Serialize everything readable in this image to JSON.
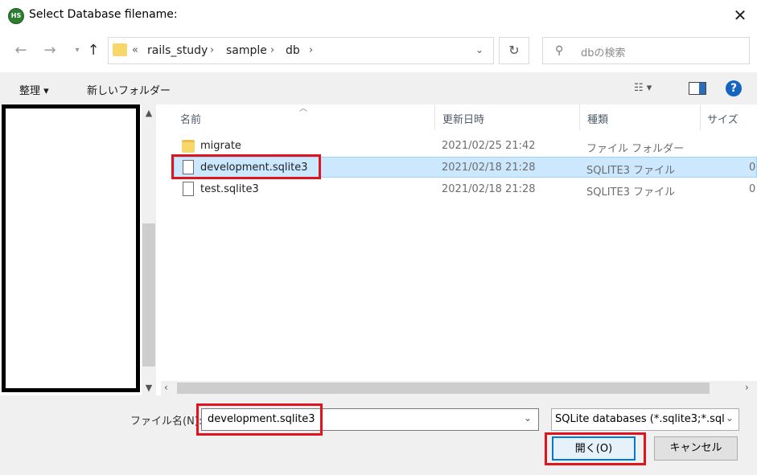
{
  "window": {
    "title": "Select Database filename:",
    "icon_text": "HS"
  },
  "nav": {
    "breadcrumb": [
      "rails_study",
      "sample",
      "db"
    ],
    "search_placeholder": "dbの検索"
  },
  "toolbar": {
    "organize": "整理 ▾",
    "new_folder": "新しいフォルダー"
  },
  "columns": {
    "name": "名前",
    "date": "更新日時",
    "type": "種類",
    "size": "サイズ"
  },
  "files": [
    {
      "name": "migrate",
      "date": "2021/02/25 21:42",
      "type": "ファイル フォルダー",
      "size": "",
      "kind": "folder",
      "selected": false
    },
    {
      "name": "development.sqlite3",
      "date": "2021/02/18 21:28",
      "type": "SQLITE3 ファイル",
      "size": "0",
      "kind": "file",
      "selected": true
    },
    {
      "name": "test.sqlite3",
      "date": "2021/02/18 21:28",
      "type": "SQLITE3 ファイル",
      "size": "0",
      "kind": "file",
      "selected": false
    }
  ],
  "filename": {
    "label": "ファイル名(N):",
    "value": "development.sqlite3"
  },
  "filetype": {
    "value": "SQLite databases (*.sqlite3;*.sql"
  },
  "buttons": {
    "open": "開く(O)",
    "cancel": "キャンセル"
  },
  "colors": {
    "selection": "#cce8ff",
    "highlight_red": "#e0141e",
    "help_blue": "#1565c0"
  }
}
